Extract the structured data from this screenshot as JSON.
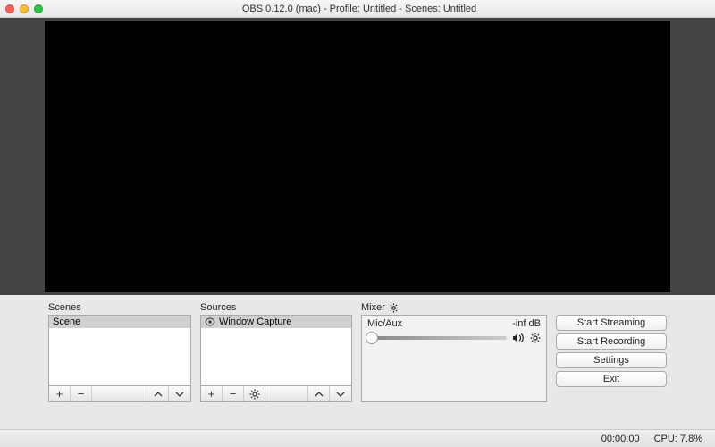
{
  "titlebar": {
    "title": "OBS 0.12.0 (mac) - Profile: Untitled - Scenes: Untitled"
  },
  "scenes": {
    "label": "Scenes",
    "items": [
      {
        "name": "Scene",
        "selected": true
      }
    ]
  },
  "sources": {
    "label": "Sources",
    "items": [
      {
        "name": "Window Capture",
        "visible": true,
        "selected": true
      }
    ]
  },
  "mixer": {
    "label": "Mixer",
    "channel": {
      "name": "Mic/Aux",
      "level": "-inf dB"
    }
  },
  "controls": {
    "start_streaming": "Start Streaming",
    "start_recording": "Start Recording",
    "settings": "Settings",
    "exit": "Exit"
  },
  "status": {
    "time": "00:00:00",
    "cpu": "CPU: 7.8%"
  }
}
